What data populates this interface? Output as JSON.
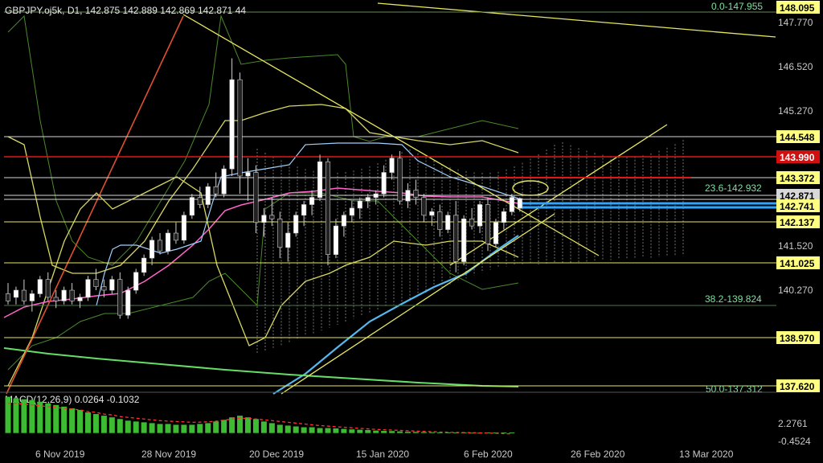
{
  "header": {
    "symbol": "GBPJPY.oj5k",
    "timeframe": "D1",
    "ohlc": "142.875 142.889 142.869 142.871 44"
  },
  "macd": {
    "label": "MACD(12,26,9)",
    "values": "0.0264 -0.1032",
    "axis_top": "2.2761",
    "axis_bottom": "-0.4524"
  },
  "price_axis": {
    "ticks": [
      "147.770",
      "146.520",
      "145.270",
      "140.270",
      "141.520"
    ]
  },
  "price_labels": [
    {
      "text": "148.095",
      "bg": "#ffff80",
      "fg": "#000000"
    },
    {
      "text": "144.548",
      "bg": "#ffff80",
      "fg": "#000000"
    },
    {
      "text": "143.990",
      "bg": "#d01010",
      "fg": "#ffffff"
    },
    {
      "text": "143.372",
      "bg": "#ffff80",
      "fg": "#000000"
    },
    {
      "text": "142.871",
      "bg": "#d8d8d8",
      "fg": "#000000"
    },
    {
      "text": "142.741",
      "bg": "#ffff80",
      "fg": "#000000"
    },
    {
      "text": "142.137",
      "bg": "#ffff80",
      "fg": "#000000"
    },
    {
      "text": "141.025",
      "bg": "#ffff80",
      "fg": "#000000"
    },
    {
      "text": "138.970",
      "bg": "#ffff80",
      "fg": "#000000"
    },
    {
      "text": "137.620",
      "bg": "#ffff80",
      "fg": "#000000"
    }
  ],
  "fib_labels": [
    {
      "text": "0.0-147.955"
    },
    {
      "text": "23.6-142.932"
    },
    {
      "text": "38.2-139.824"
    },
    {
      "text": "50.0-137.312"
    }
  ],
  "date_axis": {
    "labels": [
      "6 Nov 2019",
      "28 Nov 2019",
      "20 Dec 2019",
      "15 Jan 2020",
      "6 Feb 2020",
      "26 Feb 2020",
      "13 Mar 2020"
    ]
  },
  "colors": {
    "background": "#000000",
    "bull_candle": "#ffffff",
    "bear_candle": "#222222",
    "resistance_red": "#e01818",
    "trend_yellow": "#e8e860",
    "kumo": "#b0b0b0",
    "ma_pink": "#ff66cc",
    "ma_blue": "#66ccff",
    "ma_green": "#55dd55",
    "macd_bars": "#3dbb33",
    "macd_signal": "#ff3030"
  },
  "chart_data": {
    "type": "candlestick",
    "instrument": "GBPJPY.oj5k",
    "timeframe": "D1",
    "candles": [
      {
        "o": 140.2,
        "h": 140.5,
        "l": 139.9,
        "c": 140.0
      },
      {
        "o": 140.1,
        "h": 140.4,
        "l": 139.9,
        "c": 140.3
      },
      {
        "o": 140.3,
        "h": 140.6,
        "l": 139.9,
        "c": 140.0
      },
      {
        "o": 140.0,
        "h": 140.3,
        "l": 139.7,
        "c": 140.2
      },
      {
        "o": 140.2,
        "h": 140.7,
        "l": 140.1,
        "c": 140.6
      },
      {
        "o": 140.6,
        "h": 140.8,
        "l": 140.0,
        "c": 140.1
      },
      {
        "o": 140.1,
        "h": 140.3,
        "l": 139.8,
        "c": 140.0
      },
      {
        "o": 140.0,
        "h": 140.4,
        "l": 139.9,
        "c": 140.3
      },
      {
        "o": 140.3,
        "h": 140.5,
        "l": 139.9,
        "c": 140.0
      },
      {
        "o": 140.0,
        "h": 140.2,
        "l": 139.8,
        "c": 140.1
      },
      {
        "o": 140.1,
        "h": 140.7,
        "l": 140.0,
        "c": 140.6
      },
      {
        "o": 140.6,
        "h": 140.9,
        "l": 140.3,
        "c": 140.4
      },
      {
        "o": 140.4,
        "h": 140.6,
        "l": 140.1,
        "c": 140.3
      },
      {
        "o": 140.3,
        "h": 140.7,
        "l": 140.2,
        "c": 140.6
      },
      {
        "o": 140.6,
        "h": 140.8,
        "l": 139.5,
        "c": 139.6
      },
      {
        "o": 139.6,
        "h": 140.4,
        "l": 139.5,
        "c": 140.3
      },
      {
        "o": 140.3,
        "h": 140.9,
        "l": 140.2,
        "c": 140.8
      },
      {
        "o": 140.8,
        "h": 141.3,
        "l": 140.7,
        "c": 141.2
      },
      {
        "o": 141.2,
        "h": 141.8,
        "l": 141.0,
        "c": 141.7
      },
      {
        "o": 141.7,
        "h": 141.9,
        "l": 141.3,
        "c": 141.4
      },
      {
        "o": 141.4,
        "h": 142.0,
        "l": 141.3,
        "c": 141.9
      },
      {
        "o": 141.9,
        "h": 142.2,
        "l": 141.6,
        "c": 141.7
      },
      {
        "o": 141.7,
        "h": 142.5,
        "l": 141.6,
        "c": 142.4
      },
      {
        "o": 142.4,
        "h": 143.0,
        "l": 142.3,
        "c": 142.9
      },
      {
        "o": 142.9,
        "h": 143.2,
        "l": 142.6,
        "c": 142.7
      },
      {
        "o": 142.7,
        "h": 143.3,
        "l": 142.6,
        "c": 143.2
      },
      {
        "o": 143.2,
        "h": 143.6,
        "l": 142.9,
        "c": 143.0
      },
      {
        "o": 143.0,
        "h": 143.8,
        "l": 142.9,
        "c": 143.7
      },
      {
        "o": 143.7,
        "h": 146.8,
        "l": 143.5,
        "c": 146.2
      },
      {
        "o": 146.2,
        "h": 146.4,
        "l": 143.0,
        "c": 143.5
      },
      {
        "o": 143.5,
        "h": 144.0,
        "l": 142.8,
        "c": 143.6
      },
      {
        "o": 143.6,
        "h": 143.8,
        "l": 141.9,
        "c": 142.2
      },
      {
        "o": 142.2,
        "h": 142.6,
        "l": 141.8,
        "c": 142.4
      },
      {
        "o": 142.4,
        "h": 142.9,
        "l": 142.1,
        "c": 142.3
      },
      {
        "o": 142.3,
        "h": 142.5,
        "l": 141.2,
        "c": 141.5
      },
      {
        "o": 141.5,
        "h": 142.2,
        "l": 141.1,
        "c": 141.9
      },
      {
        "o": 141.9,
        "h": 142.5,
        "l": 141.8,
        "c": 142.4
      },
      {
        "o": 142.4,
        "h": 142.8,
        "l": 142.1,
        "c": 142.7
      },
      {
        "o": 142.7,
        "h": 143.1,
        "l": 142.4,
        "c": 142.9
      },
      {
        "o": 142.9,
        "h": 144.1,
        "l": 142.8,
        "c": 143.9
      },
      {
        "o": 143.9,
        "h": 144.0,
        "l": 141.0,
        "c": 141.3
      },
      {
        "o": 141.3,
        "h": 142.3,
        "l": 141.2,
        "c": 142.1
      },
      {
        "o": 142.1,
        "h": 142.5,
        "l": 141.8,
        "c": 142.4
      },
      {
        "o": 142.4,
        "h": 142.8,
        "l": 142.2,
        "c": 142.6
      },
      {
        "o": 142.6,
        "h": 142.9,
        "l": 142.3,
        "c": 142.8
      },
      {
        "o": 142.8,
        "h": 143.0,
        "l": 142.6,
        "c": 142.9
      },
      {
        "o": 142.9,
        "h": 143.1,
        "l": 142.7,
        "c": 143.0
      },
      {
        "o": 143.0,
        "h": 143.8,
        "l": 142.9,
        "c": 143.6
      },
      {
        "o": 143.6,
        "h": 144.1,
        "l": 143.4,
        "c": 144.0
      },
      {
        "o": 144.0,
        "h": 144.2,
        "l": 142.7,
        "c": 142.8
      },
      {
        "o": 142.8,
        "h": 143.3,
        "l": 142.6,
        "c": 143.1
      },
      {
        "o": 143.1,
        "h": 143.4,
        "l": 142.7,
        "c": 142.9
      },
      {
        "o": 142.9,
        "h": 143.0,
        "l": 142.2,
        "c": 142.4
      },
      {
        "o": 142.4,
        "h": 142.6,
        "l": 142.1,
        "c": 142.5
      },
      {
        "o": 142.5,
        "h": 142.7,
        "l": 141.8,
        "c": 142.0
      },
      {
        "o": 142.0,
        "h": 142.5,
        "l": 141.9,
        "c": 142.4
      },
      {
        "o": 142.4,
        "h": 142.8,
        "l": 140.8,
        "c": 141.1
      },
      {
        "o": 141.1,
        "h": 142.4,
        "l": 141.0,
        "c": 142.3
      },
      {
        "o": 142.3,
        "h": 142.6,
        "l": 142.0,
        "c": 142.1
      },
      {
        "o": 142.1,
        "h": 142.8,
        "l": 141.9,
        "c": 142.7
      },
      {
        "o": 142.7,
        "h": 142.9,
        "l": 141.4,
        "c": 141.6
      },
      {
        "o": 141.6,
        "h": 142.3,
        "l": 141.5,
        "c": 142.2
      },
      {
        "o": 142.2,
        "h": 142.6,
        "l": 142.0,
        "c": 142.5
      },
      {
        "o": 142.5,
        "h": 143.0,
        "l": 142.4,
        "c": 142.9
      },
      {
        "o": 142.6,
        "h": 142.9,
        "l": 142.5,
        "c": 142.87
      }
    ],
    "macd": [
      2.2,
      2.1,
      2.05,
      2.0,
      1.9,
      1.8,
      1.7,
      1.6,
      1.5,
      1.4,
      1.25,
      1.15,
      1.05,
      0.95,
      0.85,
      0.75,
      0.7,
      0.65,
      0.6,
      0.55,
      0.55,
      0.5,
      0.5,
      0.5,
      0.55,
      0.6,
      0.7,
      0.8,
      0.95,
      1.05,
      0.95,
      0.85,
      0.7,
      0.6,
      0.5,
      0.45,
      0.4,
      0.35,
      0.35,
      0.3,
      0.3,
      0.28,
      0.25,
      0.22,
      0.2,
      0.18,
      0.15,
      0.13,
      0.12,
      0.1,
      0.08,
      0.07,
      0.06,
      0.05,
      0.04,
      0.04,
      0.03,
      0.03,
      0.02,
      0.02,
      0.03,
      0.03,
      0.03,
      0.03
    ],
    "signal": [
      1.8,
      1.8,
      1.75,
      1.7,
      1.65,
      1.6,
      1.55,
      1.5,
      1.45,
      1.4,
      1.3,
      1.25,
      1.15,
      1.1,
      1.0,
      0.95,
      0.9,
      0.85,
      0.8,
      0.75,
      0.72,
      0.7,
      0.68,
      0.65,
      0.66,
      0.68,
      0.72,
      0.78,
      0.85,
      0.9,
      0.88,
      0.85,
      0.8,
      0.75,
      0.7,
      0.65,
      0.6,
      0.55,
      0.5,
      0.45,
      0.42,
      0.38,
      0.35,
      0.32,
      0.28,
      0.25,
      0.22,
      0.2,
      0.18,
      0.16,
      0.14,
      0.12,
      0.1,
      0.08,
      0.06,
      0.05,
      0.04,
      0.03,
      0.02,
      0.01,
      0.0,
      -0.02,
      -0.04,
      -0.05
    ],
    "ylim": [
      137.3,
      148.3
    ],
    "macd_ylim": [
      -0.4524,
      2.2761
    ]
  }
}
